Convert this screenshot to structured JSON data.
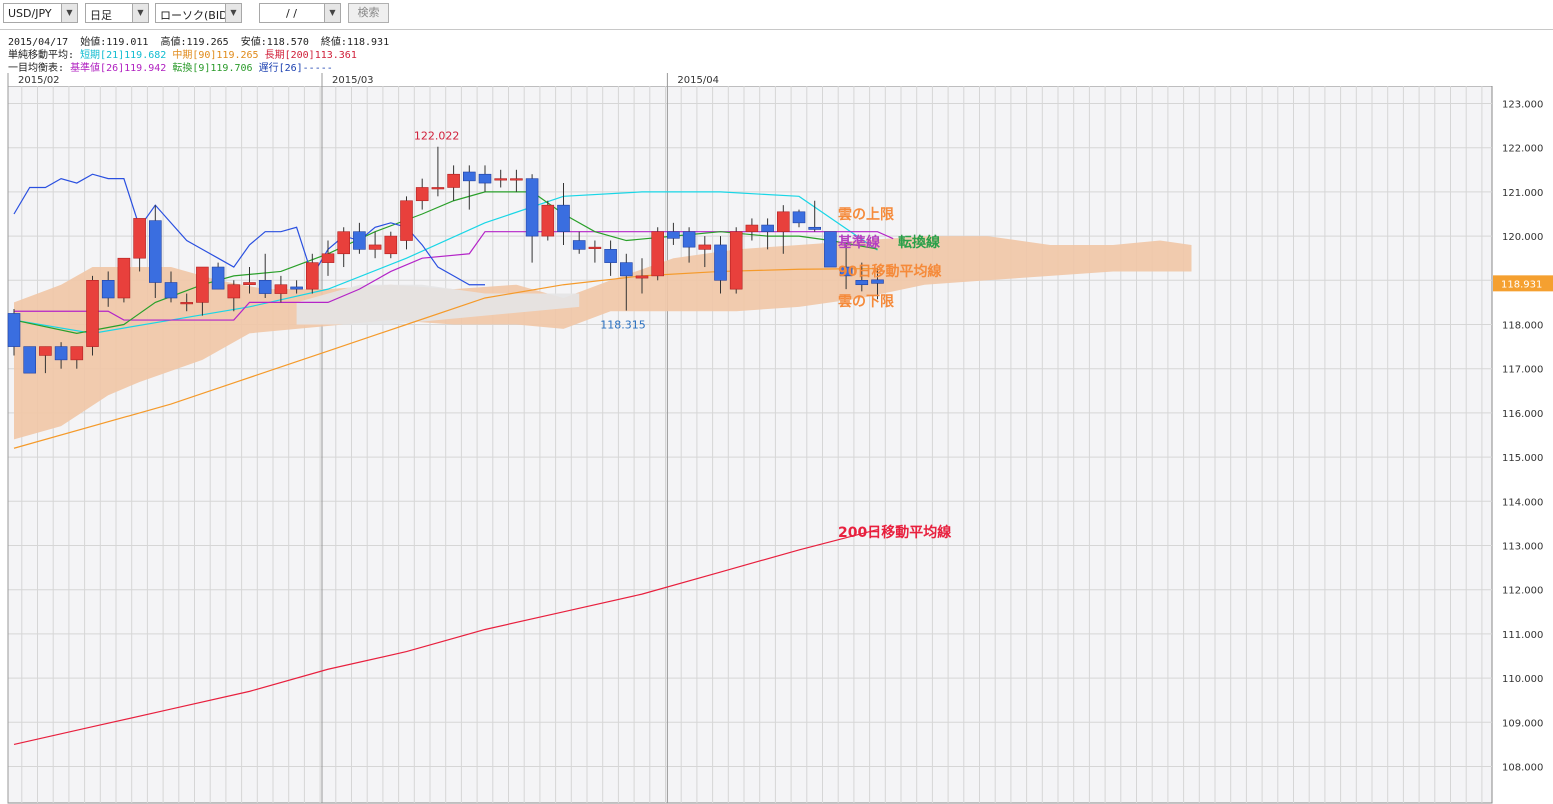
{
  "toolbar": {
    "pair": "USD/JPY",
    "period": "日足",
    "chart_type": "ローソク(BID)",
    "date_value": "/ /",
    "search_label": "検索"
  },
  "info": {
    "ohlc": {
      "date": "2015/04/17",
      "open": "始値:119.011",
      "high": "高値:119.265",
      "low": "安値:118.570",
      "close": "終値:118.931"
    },
    "sma_label": "単純移動平均:",
    "sma_short": "短期[21]119.682",
    "sma_mid": "中期[90]119.265",
    "sma_long": "長期[200]113.361",
    "ichimoku_label": "一目均衡表:",
    "kijun": "基準値[26]119.942",
    "tenkan": "転換[9]119.706",
    "chikou": "遅行[26]-----"
  },
  "chart_data": {
    "type": "candlestick",
    "y_ticks": [
      "123.000",
      "122.000",
      "121.000",
      "120.000",
      "119.000",
      "118.000",
      "117.000",
      "116.000",
      "115.000",
      "114.000",
      "113.000",
      "112.000",
      "111.000",
      "110.000",
      "109.000",
      "108.000"
    ],
    "ylim": [
      107.0,
      123.5
    ],
    "x_labels": [
      {
        "label": "2015/02",
        "index": 0
      },
      {
        "label": "2015/03",
        "index": 20
      },
      {
        "label": "2015/04",
        "index": 42
      }
    ],
    "last_price_label": "118.931",
    "high_annotation": {
      "label": "122.022",
      "index": 27,
      "value": 122.022
    },
    "low_annotation": {
      "label": "118.315",
      "index": 39,
      "value": 118.315
    },
    "candles": [
      {
        "o": 118.25,
        "h": 118.35,
        "l": 117.3,
        "c": 117.5
      },
      {
        "o": 117.5,
        "h": 117.5,
        "l": 116.9,
        "c": 116.9
      },
      {
        "o": 117.3,
        "h": 117.5,
        "l": 116.9,
        "c": 117.5
      },
      {
        "o": 117.5,
        "h": 117.6,
        "l": 117.0,
        "c": 117.2
      },
      {
        "o": 117.2,
        "h": 117.5,
        "l": 117.0,
        "c": 117.5
      },
      {
        "o": 117.5,
        "h": 119.1,
        "l": 117.3,
        "c": 119.0
      },
      {
        "o": 119.0,
        "h": 119.2,
        "l": 118.4,
        "c": 118.6
      },
      {
        "o": 118.6,
        "h": 119.5,
        "l": 118.5,
        "c": 119.5
      },
      {
        "o": 119.5,
        "h": 120.4,
        "l": 119.2,
        "c": 120.4
      },
      {
        "o": 120.35,
        "h": 120.7,
        "l": 118.6,
        "c": 118.95
      },
      {
        "o": 118.95,
        "h": 119.2,
        "l": 118.5,
        "c": 118.6
      },
      {
        "o": 118.5,
        "h": 118.7,
        "l": 118.3,
        "c": 118.5
      },
      {
        "o": 118.5,
        "h": 119.3,
        "l": 118.2,
        "c": 119.3
      },
      {
        "o": 119.3,
        "h": 119.4,
        "l": 118.8,
        "c": 118.8
      },
      {
        "o": 118.6,
        "h": 119.0,
        "l": 118.3,
        "c": 118.9
      },
      {
        "o": 118.9,
        "h": 119.3,
        "l": 118.7,
        "c": 118.95
      },
      {
        "o": 119.0,
        "h": 119.6,
        "l": 118.6,
        "c": 118.7
      },
      {
        "o": 118.7,
        "h": 119.1,
        "l": 118.5,
        "c": 118.9
      },
      {
        "o": 118.85,
        "h": 119.0,
        "l": 118.7,
        "c": 118.8
      },
      {
        "o": 118.8,
        "h": 119.6,
        "l": 118.7,
        "c": 119.4
      },
      {
        "o": 119.4,
        "h": 119.9,
        "l": 119.1,
        "c": 119.6
      },
      {
        "o": 119.6,
        "h": 120.2,
        "l": 119.3,
        "c": 120.1
      },
      {
        "o": 120.1,
        "h": 120.3,
        "l": 119.6,
        "c": 119.7
      },
      {
        "o": 119.7,
        "h": 120.1,
        "l": 119.5,
        "c": 119.8
      },
      {
        "o": 119.6,
        "h": 120.1,
        "l": 119.5,
        "c": 120.0
      },
      {
        "o": 119.9,
        "h": 120.9,
        "l": 119.7,
        "c": 120.8
      },
      {
        "o": 120.8,
        "h": 121.3,
        "l": 120.6,
        "c": 121.1
      },
      {
        "o": 121.1,
        "h": 122.022,
        "l": 120.9,
        "c": 121.1
      },
      {
        "o": 121.1,
        "h": 121.6,
        "l": 120.8,
        "c": 121.4
      },
      {
        "o": 121.45,
        "h": 121.6,
        "l": 120.6,
        "c": 121.25
      },
      {
        "o": 121.4,
        "h": 121.6,
        "l": 121.0,
        "c": 121.2
      },
      {
        "o": 121.3,
        "h": 121.5,
        "l": 121.1,
        "c": 121.3
      },
      {
        "o": 121.3,
        "h": 121.5,
        "l": 121.0,
        "c": 121.3
      },
      {
        "o": 121.3,
        "h": 121.4,
        "l": 119.4,
        "c": 120.0
      },
      {
        "o": 120.0,
        "h": 120.8,
        "l": 119.9,
        "c": 120.7
      },
      {
        "o": 120.7,
        "h": 121.2,
        "l": 119.8,
        "c": 120.1
      },
      {
        "o": 119.9,
        "h": 120.1,
        "l": 119.6,
        "c": 119.7
      },
      {
        "o": 119.75,
        "h": 119.9,
        "l": 119.4,
        "c": 119.75
      },
      {
        "o": 119.7,
        "h": 119.9,
        "l": 119.1,
        "c": 119.4
      },
      {
        "o": 119.4,
        "h": 119.6,
        "l": 118.315,
        "c": 119.1
      },
      {
        "o": 119.05,
        "h": 119.5,
        "l": 118.7,
        "c": 119.1
      },
      {
        "o": 119.1,
        "h": 120.2,
        "l": 119.0,
        "c": 120.1
      },
      {
        "o": 120.1,
        "h": 120.3,
        "l": 119.8,
        "c": 119.95
      },
      {
        "o": 120.1,
        "h": 120.2,
        "l": 119.4,
        "c": 119.75
      },
      {
        "o": 119.7,
        "h": 120.0,
        "l": 119.3,
        "c": 119.8
      },
      {
        "o": 119.8,
        "h": 120.0,
        "l": 118.7,
        "c": 119.0
      },
      {
        "o": 118.8,
        "h": 120.2,
        "l": 118.7,
        "c": 120.1
      },
      {
        "o": 120.1,
        "h": 120.4,
        "l": 119.9,
        "c": 120.25
      },
      {
        "o": 120.25,
        "h": 120.4,
        "l": 119.7,
        "c": 120.1
      },
      {
        "o": 120.1,
        "h": 120.7,
        "l": 119.6,
        "c": 120.55
      },
      {
        "o": 120.55,
        "h": 120.6,
        "l": 120.2,
        "c": 120.3
      },
      {
        "o": 120.2,
        "h": 120.8,
        "l": 120.1,
        "c": 120.15
      },
      {
        "o": 120.1,
        "h": 120.1,
        "l": 119.4,
        "c": 119.3
      },
      {
        "o": 119.3,
        "h": 119.8,
        "l": 118.8,
        "c": 119.1
      },
      {
        "o": 119.0,
        "h": 119.4,
        "l": 118.75,
        "c": 118.9
      },
      {
        "o": 119.011,
        "h": 119.265,
        "l": 118.57,
        "c": 118.931
      }
    ],
    "series": [
      {
        "name": "短期[21]",
        "color": "#19d6e6",
        "values": [
          [
            0,
            118.1
          ],
          [
            5,
            117.8
          ],
          [
            10,
            118.1
          ],
          [
            15,
            118.4
          ],
          [
            20,
            118.8
          ],
          [
            25,
            119.5
          ],
          [
            30,
            120.3
          ],
          [
            35,
            120.9
          ],
          [
            40,
            121.0
          ],
          [
            45,
            121.0
          ],
          [
            50,
            120.9
          ],
          [
            55,
            119.682
          ]
        ]
      },
      {
        "name": "中期[90]",
        "color": "#f59a2a",
        "values": [
          [
            0,
            115.2
          ],
          [
            10,
            116.2
          ],
          [
            20,
            117.4
          ],
          [
            25,
            118.0
          ],
          [
            30,
            118.6
          ],
          [
            35,
            118.9
          ],
          [
            40,
            119.1
          ],
          [
            45,
            119.2
          ],
          [
            50,
            119.25
          ],
          [
            55,
            119.265
          ]
        ]
      },
      {
        "name": "長期[200]",
        "color": "#e8203e",
        "values": [
          [
            0,
            108.5
          ],
          [
            5,
            108.9
          ],
          [
            10,
            109.3
          ],
          [
            15,
            109.7
          ],
          [
            20,
            110.2
          ],
          [
            25,
            110.6
          ],
          [
            30,
            111.1
          ],
          [
            35,
            111.5
          ],
          [
            40,
            111.9
          ],
          [
            45,
            112.4
          ],
          [
            50,
            112.9
          ],
          [
            55,
            113.361
          ]
        ]
      },
      {
        "name": "基準値[26]",
        "color": "#b424c8",
        "values": [
          [
            0,
            118.3
          ],
          [
            6,
            118.3
          ],
          [
            7,
            118.1
          ],
          [
            14,
            118.1
          ],
          [
            15,
            118.5
          ],
          [
            20,
            118.5
          ],
          [
            22,
            118.8
          ],
          [
            24,
            119.2
          ],
          [
            26,
            119.5
          ],
          [
            29,
            119.6
          ],
          [
            30,
            120.1
          ],
          [
            55,
            120.1
          ],
          [
            56,
            119.942
          ]
        ]
      },
      {
        "name": "転換[9]",
        "color": "#2aa02a",
        "values": [
          [
            0,
            118.1
          ],
          [
            4,
            117.8
          ],
          [
            7,
            118.0
          ],
          [
            9,
            118.5
          ],
          [
            12,
            118.9
          ],
          [
            14,
            119.1
          ],
          [
            17,
            119.2
          ],
          [
            20,
            119.6
          ],
          [
            23,
            120.1
          ],
          [
            26,
            120.5
          ],
          [
            28,
            120.8
          ],
          [
            30,
            121.0
          ],
          [
            33,
            121.0
          ],
          [
            35,
            120.5
          ],
          [
            37,
            120.1
          ],
          [
            39,
            119.9
          ],
          [
            42,
            120.0
          ],
          [
            45,
            120.1
          ],
          [
            48,
            120.0
          ],
          [
            50,
            120.0
          ],
          [
            52,
            119.9
          ],
          [
            55,
            119.706
          ]
        ]
      },
      {
        "name": "遅行[26]",
        "color": "#2a50e0",
        "values": [
          [
            0,
            120.5
          ],
          [
            1,
            121.1
          ],
          [
            2,
            121.1
          ],
          [
            3,
            121.3
          ],
          [
            4,
            121.2
          ],
          [
            5,
            121.4
          ],
          [
            6,
            121.3
          ],
          [
            7,
            121.3
          ],
          [
            8,
            120.2
          ],
          [
            9,
            120.7
          ],
          [
            10,
            120.3
          ],
          [
            11,
            119.9
          ],
          [
            12,
            119.7
          ],
          [
            13,
            119.5
          ],
          [
            14,
            119.3
          ],
          [
            15,
            119.8
          ],
          [
            16,
            120.1
          ],
          [
            17,
            120.1
          ],
          [
            18,
            120.2
          ],
          [
            19,
            119.1
          ],
          [
            20,
            119.7
          ],
          [
            21,
            120.0
          ],
          [
            22,
            119.9
          ],
          [
            23,
            120.2
          ],
          [
            24,
            120.3
          ],
          [
            25,
            120.2
          ],
          [
            26,
            119.8
          ],
          [
            27,
            119.3
          ],
          [
            28,
            119.1
          ],
          [
            29,
            118.9
          ],
          [
            30,
            118.9
          ]
        ]
      }
    ],
    "cloud": {
      "color_up": "#f1c7a6",
      "color_down": "#e4e4e6",
      "upper": [
        [
          0,
          118.5
        ],
        [
          3,
          118.9
        ],
        [
          5,
          119.3
        ],
        [
          10,
          119.3
        ],
        [
          13,
          119.0
        ],
        [
          16,
          118.8
        ],
        [
          20,
          118.8
        ],
        [
          24,
          118.9
        ],
        [
          28,
          118.8
        ],
        [
          32,
          118.9
        ],
        [
          35,
          118.6
        ],
        [
          38,
          119.0
        ],
        [
          42,
          119.5
        ],
        [
          46,
          119.7
        ],
        [
          50,
          119.8
        ],
        [
          54,
          119.9
        ],
        [
          58,
          120.0
        ],
        [
          62,
          120.0
        ],
        [
          66,
          119.8
        ],
        [
          70,
          119.8
        ],
        [
          73,
          119.9
        ],
        [
          75,
          119.8
        ]
      ],
      "lower": [
        [
          0,
          115.4
        ],
        [
          3,
          115.7
        ],
        [
          6,
          116.4
        ],
        [
          8,
          116.7
        ],
        [
          12,
          117.2
        ],
        [
          15,
          117.8
        ],
        [
          18,
          117.9
        ],
        [
          21,
          118.0
        ],
        [
          24,
          118.1
        ],
        [
          28,
          118.0
        ],
        [
          32,
          118.0
        ],
        [
          35,
          117.9
        ],
        [
          38,
          118.3
        ],
        [
          42,
          118.3
        ],
        [
          46,
          118.3
        ],
        [
          50,
          118.4
        ],
        [
          54,
          118.6
        ],
        [
          58,
          118.9
        ],
        [
          62,
          119.0
        ],
        [
          66,
          119.1
        ],
        [
          70,
          119.2
        ],
        [
          73,
          119.2
        ],
        [
          75,
          119.2
        ]
      ]
    },
    "annotations": [
      {
        "label": "雲の上限",
        "color": "#f58a3a"
      },
      {
        "label": "基準線",
        "color": "#b540c0"
      },
      {
        "label": "転換線",
        "color": "#2aa04a"
      },
      {
        "label": "90日移動平均線",
        "color": "#f58a3a"
      },
      {
        "label": "雲の下限",
        "color": "#f58a3a"
      },
      {
        "label": "200日移動平均線",
        "color": "#e8203e"
      }
    ],
    "colors": {
      "up": "#e8403c",
      "down": "#3a6ee0",
      "grid": "#d6d6d6",
      "bg": "#f4f4f6"
    }
  }
}
